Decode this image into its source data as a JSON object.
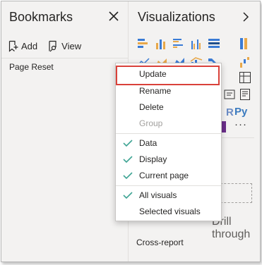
{
  "bookmarks": {
    "title": "Bookmarks",
    "add_label": "Add",
    "view_label": "View",
    "items": [
      {
        "label": "Page Reset"
      }
    ]
  },
  "visualizations": {
    "title": "Visualizations",
    "python_label": "Py",
    "more_label": "···",
    "drill_label": "Drill through",
    "cross_report_label": "Cross-report"
  },
  "context_menu": {
    "items": [
      {
        "label": "Update",
        "highlighted": true
      },
      {
        "label": "Rename"
      },
      {
        "label": "Delete"
      },
      {
        "label": "Group",
        "disabled": true
      },
      {
        "label": "Data",
        "checked": true
      },
      {
        "label": "Display",
        "checked": true
      },
      {
        "label": "Current page",
        "checked": true
      },
      {
        "label": "All visuals",
        "checked": true
      },
      {
        "label": "Selected visuals"
      }
    ]
  },
  "colors": {
    "highlight_border": "#d9413a",
    "check_teal": "#3fa494",
    "pane_bg": "#f3f2f1"
  }
}
